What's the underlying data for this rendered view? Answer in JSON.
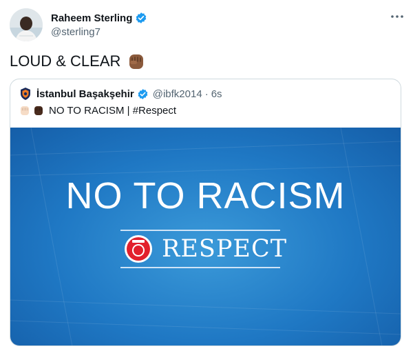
{
  "author": {
    "name": "Raheem Sterling",
    "handle": "@sterling7"
  },
  "tweet": {
    "text": "LOUD & CLEAR"
  },
  "quoted": {
    "name": "İstanbul Başakşehir",
    "handle": "@ibfk2014",
    "separator": "·",
    "time": "6s",
    "text": "NO TO RACISM | #Respect",
    "image": {
      "title": "NO TO RACISM",
      "subtitle": "RESPECT"
    }
  },
  "colors": {
    "verified": "#1d9bf0",
    "image_blue": "#1f78c4",
    "secondary_text": "#536471"
  },
  "icons": [
    "avatar",
    "verified-badge-icon",
    "more-icon",
    "raised-fist-icon",
    "club-logo",
    "uefa-logo"
  ]
}
